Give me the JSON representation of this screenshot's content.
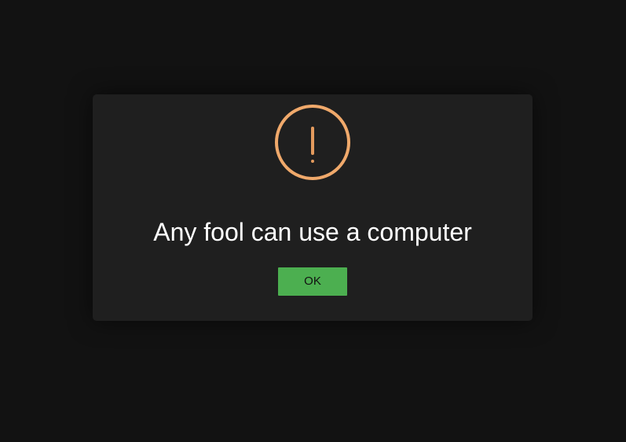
{
  "dialog": {
    "icon": "warning-exclamation-icon",
    "message": "Any fool can use a computer",
    "ok_label": "OK"
  },
  "colors": {
    "background": "#121212",
    "dialog_background": "#1f1f1f",
    "icon_accent": "#f0a96b",
    "button": "#4caf50",
    "text": "#ffffff"
  }
}
